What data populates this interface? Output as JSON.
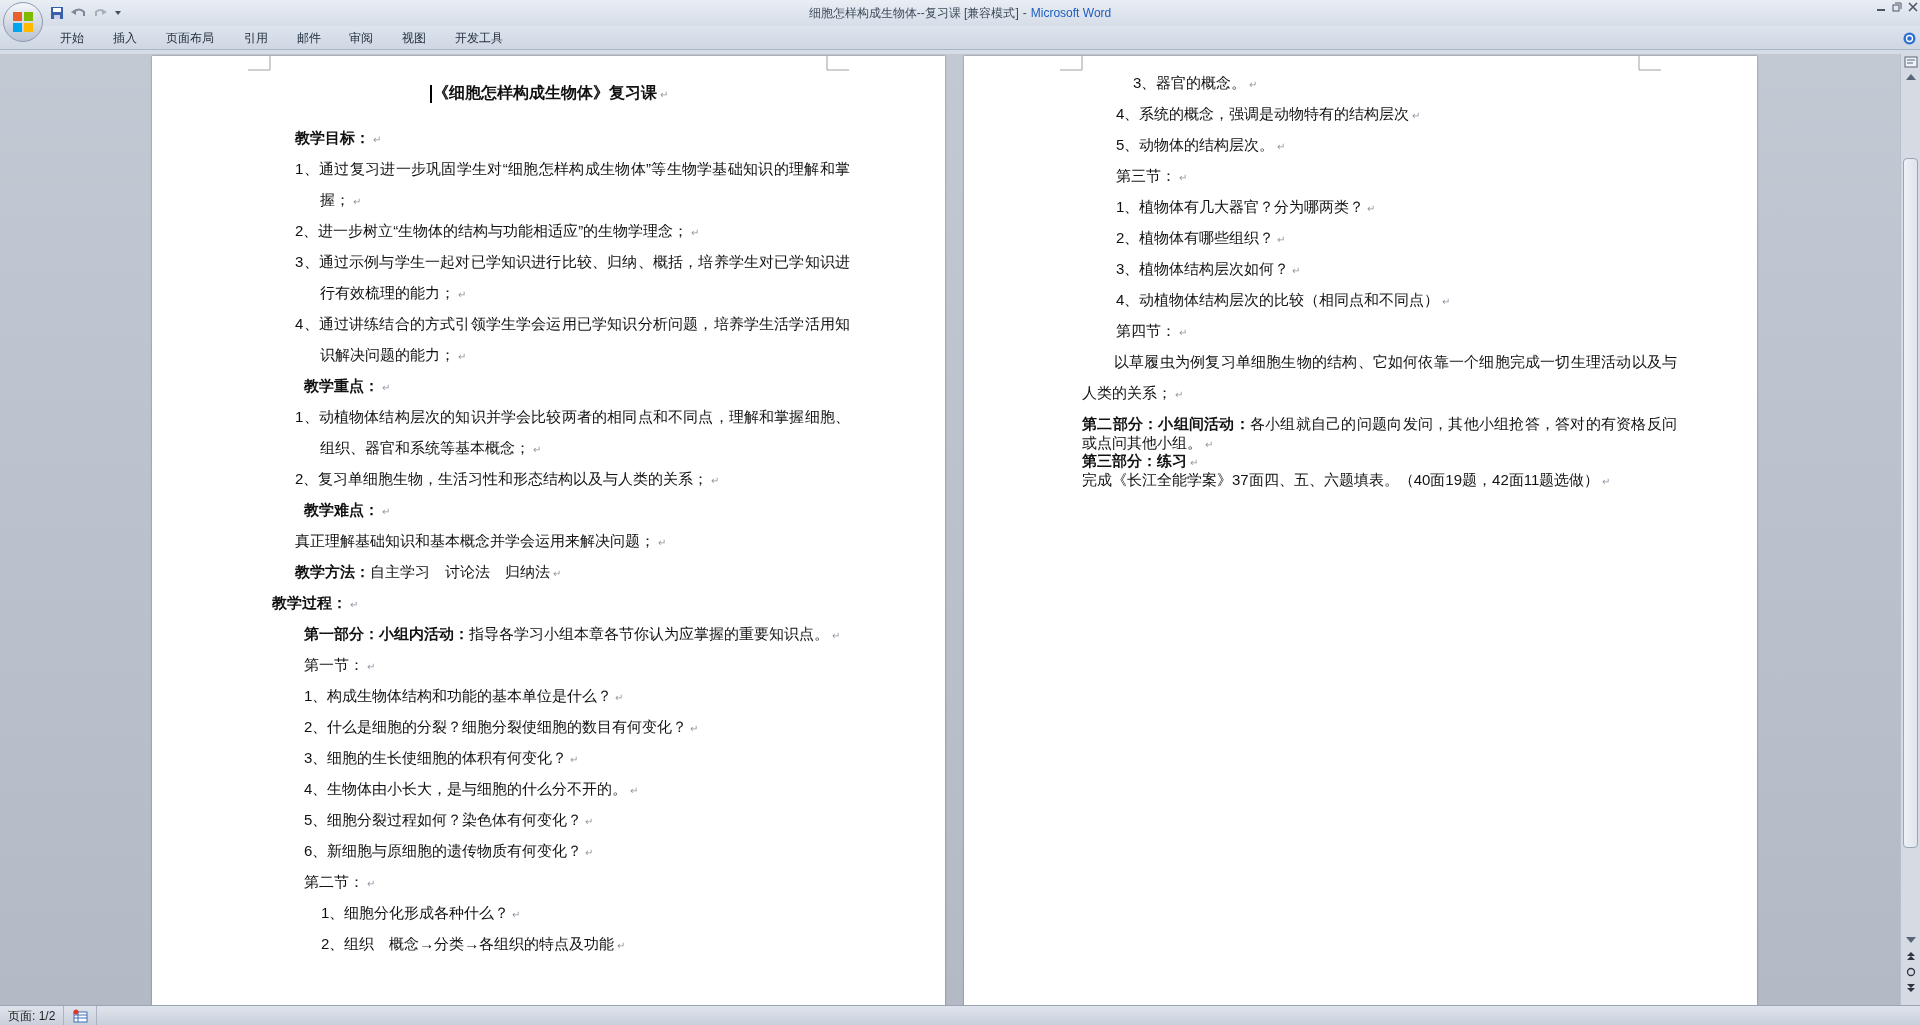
{
  "window": {
    "document_title": "细胞怎样构成生物体--复习课 [兼容模式]",
    "separator": "-",
    "app_name": "Microsoft Word"
  },
  "ribbon_tabs": [
    {
      "label": "开始"
    },
    {
      "label": "插入"
    },
    {
      "label": "页面布局"
    },
    {
      "label": "引用"
    },
    {
      "label": "邮件"
    },
    {
      "label": "审阅"
    },
    {
      "label": "视图"
    },
    {
      "label": "开发工具"
    }
  ],
  "pages": [
    {
      "paragraphs": [
        {
          "kind": "title",
          "text": "《细胞怎样构成生物体》复习课",
          "end_mark": "↵",
          "cursor": true
        },
        {
          "kind": "label",
          "text": "教学目标：",
          "end_mark": "↵"
        },
        {
          "kind": "numbered",
          "text": "1、通过复习进一步巩固学生对“细胞怎样构成生物体”等生物学基础知识的理解和掌握；",
          "end_mark": "↵"
        },
        {
          "kind": "numbered",
          "text": "2、进一步树立“生物体的结构与功能相适应”的生物学理念；",
          "end_mark": "↵"
        },
        {
          "kind": "numbered",
          "text": "3、通过示例与学生一起对已学知识进行比较、归纳、概括，培养学生对已学知识进行有效梳理的能力；",
          "end_mark": "↵"
        },
        {
          "kind": "numbered",
          "text": "4、通过讲练结合的方式引领学生学会运用已学知识分析问题，培养学生活学活用知识解决问题的能力；",
          "end_mark": "↵"
        },
        {
          "kind": "label2",
          "text": "教学重点：",
          "end_mark": "↵"
        },
        {
          "kind": "numbered",
          "text": "1、动植物体结构层次的知识并学会比较两者的相同点和不同点，理解和掌握细胞、组织、器官和系统等基本概念；",
          "end_mark": "↵"
        },
        {
          "kind": "numbered",
          "text": "2、复习单细胞生物，生活习性和形态结构以及与人类的关系；",
          "end_mark": "↵"
        },
        {
          "kind": "label2",
          "text": "教学难点：",
          "end_mark": "↵"
        },
        {
          "kind": "plain",
          "text": "真正理解基础知识和基本概念并学会运用来解决问题；",
          "end_mark": "↵"
        },
        {
          "kind": "plain",
          "text": "**教学方法：**自主学习　讨论法　归纳法",
          "end_mark": "↵"
        },
        {
          "kind": "process",
          "text": "教学过程：",
          "end_mark": "↵"
        },
        {
          "kind": "step",
          "text": "**第一部分：小组内活动：**指导各学习小组本章各节你认为应掌握的重要知识点。",
          "end_mark": "↵"
        },
        {
          "kind": "step",
          "text": "第一节：",
          "end_mark": "↵"
        },
        {
          "kind": "step",
          "text": "1、构成生物体结构和功能的基本单位是什么？",
          "end_mark": "↵"
        },
        {
          "kind": "step",
          "text": "2、什么是细胞的分裂？细胞分裂使细胞的数目有何变化？",
          "end_mark": "↵"
        },
        {
          "kind": "step",
          "text": "3、细胞的生长使细胞的体积有何变化？",
          "end_mark": "↵"
        },
        {
          "kind": "step",
          "text": "4、生物体由小长大，是与细胞的什么分不开的。",
          "end_mark": "↵"
        },
        {
          "kind": "step",
          "text": "5、细胞分裂过程如何？染色体有何变化？",
          "end_mark": "↵"
        },
        {
          "kind": "step",
          "text": "6、新细胞与原细胞的遗传物质有何变化？",
          "end_mark": "↵"
        },
        {
          "kind": "step",
          "text": "第二节：",
          "end_mark": "↵"
        },
        {
          "kind": "substep",
          "text": "1、细胞分化形成各种什么？",
          "end_mark": "↵"
        },
        {
          "kind": "substep",
          "text": "2、组织　概念→分类→各组织的特点及功能",
          "end_mark": "↵"
        }
      ]
    },
    {
      "paragraphs": [
        {
          "kind": "substep",
          "text": "3、器官的概念。",
          "end_mark": "↵"
        },
        {
          "kind": "step",
          "text": "4、系统的概念，强调是动物特有的结构层次",
          "end_mark": "↵"
        },
        {
          "kind": "step",
          "text": "5、动物体的结构层次。",
          "end_mark": "↵"
        },
        {
          "kind": "step",
          "text": "第三节：",
          "end_mark": "↵"
        },
        {
          "kind": "step",
          "text": "1、植物体有几大器官？分为哪两类？",
          "end_mark": "↵"
        },
        {
          "kind": "step",
          "text": "2、植物体有哪些组织？",
          "end_mark": "↵"
        },
        {
          "kind": "step",
          "text": "3、植物体结构层次如何？",
          "end_mark": "↵"
        },
        {
          "kind": "step",
          "text": "4、动植物体结构层次的比较（相同点和不同点）",
          "end_mark": "↵"
        },
        {
          "kind": "step",
          "text": "第四节：",
          "end_mark": "↵"
        },
        {
          "kind": "lead",
          "text": "以草履虫为例复习单细胞生物的结构、它如何依靠一个细胞完成一切生理活动以及与人类的关系；",
          "end_mark": "↵"
        },
        {
          "kind": "compact",
          "text": "**第二部分：小组间活动：**各小组就自己的问题向发问，其他小组抢答，答对的有资格反问或点问其他小组。",
          "end_mark": "↵"
        },
        {
          "kind": "compact",
          "text": "**第三部分：练习**",
          "end_mark": "↵"
        },
        {
          "kind": "compact",
          "text": "完成《长江全能学案》37面四、五、六题填表。（40面19题，42面11题选做）",
          "end_mark": "↵"
        }
      ]
    }
  ],
  "status_bar": {
    "page": "页面: 1/2"
  }
}
